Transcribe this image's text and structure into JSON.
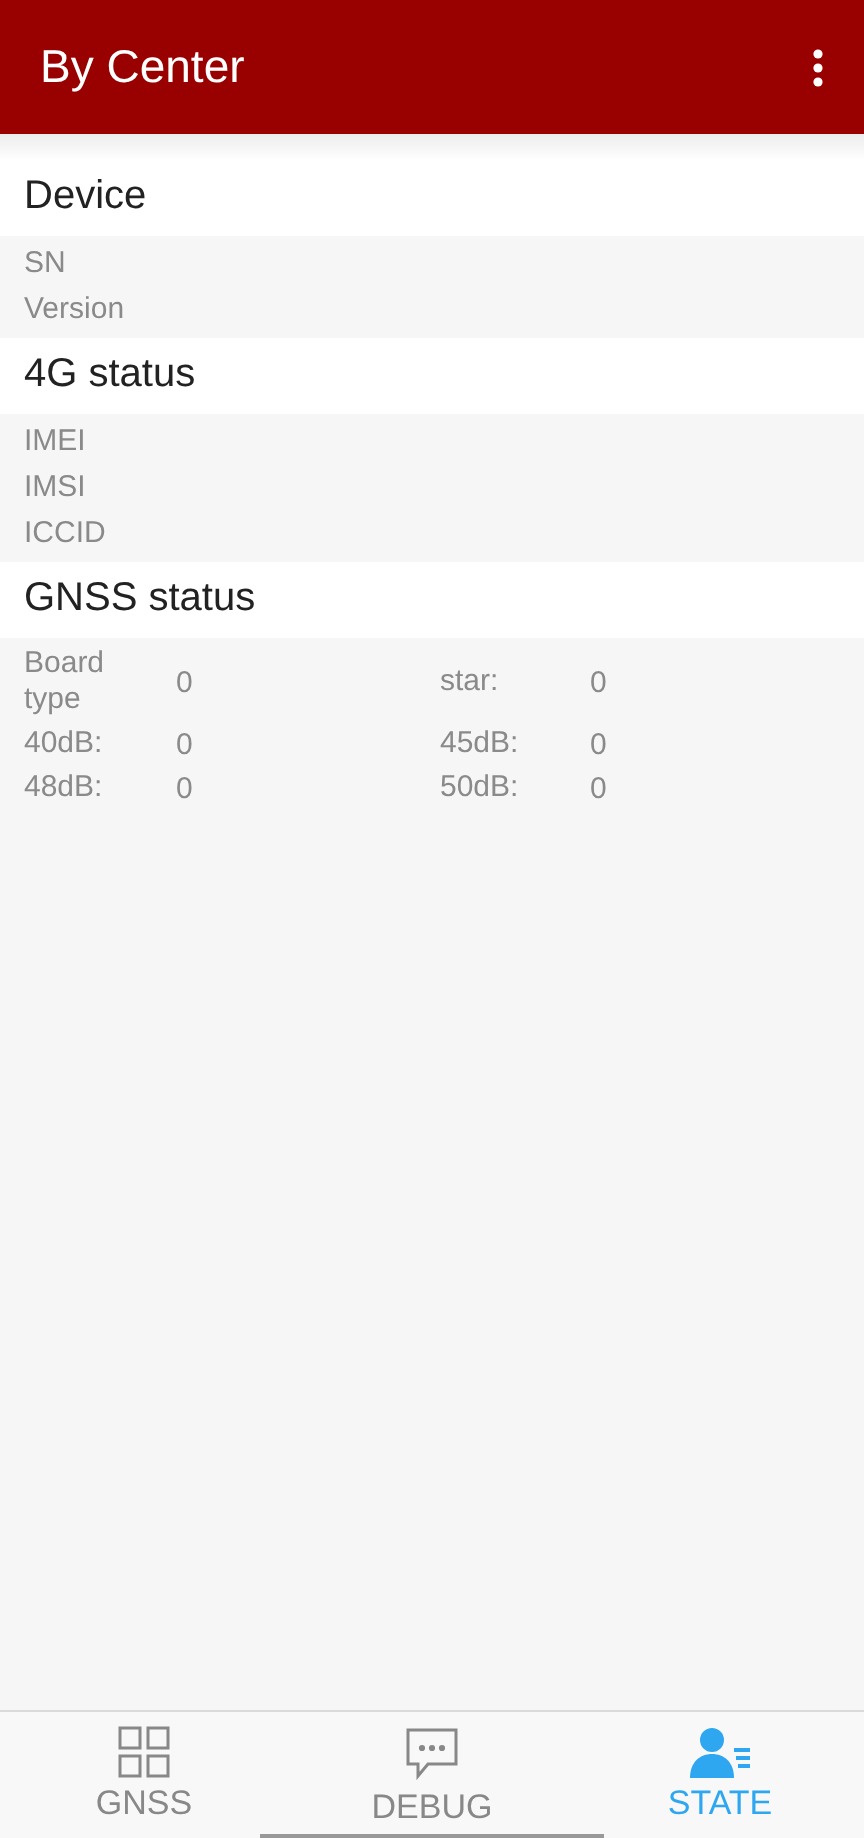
{
  "app_bar": {
    "title": "By Center"
  },
  "sections": [
    {
      "title": "Device",
      "kind": "list",
      "rows": [
        "SN",
        "Version"
      ]
    },
    {
      "title": "4G status",
      "kind": "list",
      "rows": [
        "IMEI",
        "IMSI",
        "ICCID"
      ]
    },
    {
      "title": "GNSS status",
      "kind": "grid",
      "cells": [
        {
          "label": "Board type",
          "value": "0"
        },
        {
          "label": "star:",
          "value": "0"
        },
        {
          "label": "40dB:",
          "value": "0"
        },
        {
          "label": "45dB:",
          "value": "0"
        },
        {
          "label": "48dB:",
          "value": "0"
        },
        {
          "label": "50dB:",
          "value": "0"
        }
      ]
    }
  ],
  "tabs": [
    {
      "label": "GNSS",
      "selected": false
    },
    {
      "label": "DEBUG",
      "selected": false
    },
    {
      "label": "STATE",
      "selected": true
    }
  ]
}
